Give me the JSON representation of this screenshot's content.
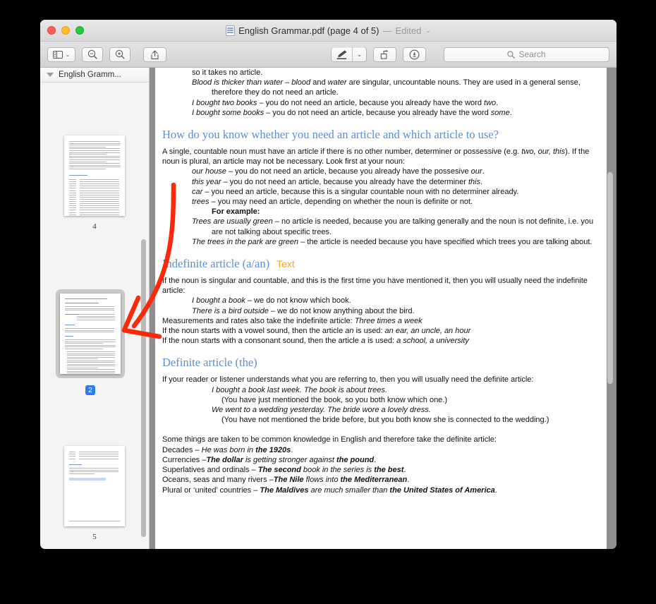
{
  "window": {
    "title_file": "English Grammar.pdf (page 4 of 5)",
    "title_sep": "—",
    "title_edited": "Edited",
    "title_chevron": "⌄"
  },
  "toolbar": {
    "sidebar_button": "sidebar-view",
    "sidebar_chevron": "⌄",
    "zoom_out": "zoom-out",
    "zoom_in": "zoom-in",
    "share": "share",
    "markup": "markup-pen",
    "markup_chevron": "⌄",
    "rotate": "rotate-left",
    "sign": "annotate",
    "search_placeholder": "Search",
    "search_value": ""
  },
  "sidebar": {
    "header_label": "English Gramm...",
    "thumbnails": [
      {
        "label": "4",
        "selected": false
      },
      {
        "label": "2",
        "selected": true
      },
      {
        "label": "5",
        "selected": false
      }
    ]
  },
  "annotations": {
    "text_note": "Text",
    "text_note_color": "#f5a623",
    "arrow_color": "#f92a09"
  },
  "document": {
    "blocks": [
      {
        "cls": "ind1h",
        "html": "so it takes no article."
      },
      {
        "cls": "hang",
        "html": "<span class=\"i\">Blood is thicker than water</span> – <span class=\"i\">blood</span> and <span class=\"i\">water</span> are singular, uncountable nouns. They are used in a general sense, therefore they do not need an article."
      },
      {
        "cls": "hang",
        "html": "<span class=\"i\">I bought two books</span> – you do not need an article, because you already have the word <span class=\"i\">two</span>."
      },
      {
        "cls": "hang",
        "html": "<span class=\"i\">I bought some books</span> – you do not need an article, because you already have the word <span class=\"i\">some</span>."
      },
      {
        "cls": "h2",
        "html": "How do you know whether you need an article and which article to use?"
      },
      {
        "cls": "",
        "html": "A single, countable noun must have an article if there is no other number, determiner or possessive (e.g. <span class=\"i\">two, our, this</span>). If the noun is plural, an article may not be necessary. Look first at your noun:"
      },
      {
        "cls": "hang",
        "html": "<span class=\"i\">our house</span> – you do not need an article, because you already have the possesive <span class=\"i\">our</span>."
      },
      {
        "cls": "hang",
        "html": "<span class=\"i\">this year</span> – you do not need an article, because you already have the determiner <span class=\"i\">this</span>."
      },
      {
        "cls": "hang",
        "html": "<span class=\"i\">car</span> – you need an article, because this is a singular countable noun with no determiner already."
      },
      {
        "cls": "hang",
        "html": "<span class=\"i\">trees</span> – you may need an article, depending on whether the noun is definite or not."
      },
      {
        "cls": "ind2",
        "html": "<span class=\"b\">For example:</span>"
      },
      {
        "cls": "hang",
        "html": "<span class=\"i\">Trees are usually green</span> – no article is needed, because you are talking generally and the noun is not definite, i.e. you are not talking about specific trees."
      },
      {
        "cls": "hang",
        "html": "<span class=\"i\">The trees in the park are green</span> – the article is needed because you have specified which trees you are talking about."
      },
      {
        "cls": "h2",
        "html": "Indefinite article (a/an)"
      },
      {
        "cls": "",
        "html": "If the noun is singular and countable, and this is the first time you have mentioned it, then you will usually need the indefinite article:"
      },
      {
        "cls": "hang",
        "html": "<span class=\"i\">I bought a book</span> – we do not know which book."
      },
      {
        "cls": "hang",
        "html": "<span class=\"i\">There is a bird outside</span> – we do not know anything about the bird."
      },
      {
        "cls": "",
        "html": "Measurements and rates also take the indefinite article: <span class=\"i\">Three times a week</span>"
      },
      {
        "cls": "",
        "html": "If the noun starts with a vowel sound, then the article <span class=\"i\">an</span> is used: <span class=\"i\">an ear, an uncle, an hour</span>"
      },
      {
        "cls": "",
        "html": "If the noun starts with a consonant sound, then the article <span class=\"i\">a</span> is used: <span class=\"i\">a school, a university</span>"
      },
      {
        "cls": "h2",
        "html": "Definite article (the)"
      },
      {
        "cls": "",
        "html": "If your reader or listener understands what you are referring to, then you will usually need the definite article:"
      },
      {
        "cls": "ind2",
        "html": "<span class=\"i\">I bought a book last week. The book is about trees.</span>"
      },
      {
        "cls": "ind3",
        "html": "(You have just mentioned the book, so you both know which one.)"
      },
      {
        "cls": "ind2",
        "html": "<span class=\"i\">We went to a wedding yesterday. The bride wore a lovely dress.</span>"
      },
      {
        "cls": "hang2",
        "html": "(You have not mentioned the bride before, but you both know she is connected to the wedding.)"
      },
      {
        "cls": "",
        "html": "Some things are taken to be common knowledge in English and therefore take the definite article:"
      },
      {
        "cls": "",
        "html": "Decades – <span class=\"i\">He was born in </span><span class=\"bi\">the 1920s</span>."
      },
      {
        "cls": "",
        "html": "Currencies –<span class=\"bi\">The dollar</span><span class=\"i\"> is getting stronger against </span><span class=\"bi\">the pound</span>."
      },
      {
        "cls": "",
        "html": "Superlatives and ordinals – <span class=\"bi\">The second</span><span class=\"i\"> book in the series is </span><span class=\"bi\">the best</span>."
      },
      {
        "cls": "",
        "html": "Oceans, seas and many rivers –<span class=\"bi\">The Nile</span><span class=\"i\"> flows into </span><span class=\"bi\">the Mediterranean</span>."
      },
      {
        "cls": "",
        "html": "Plural or ‘united’ countries – <span class=\"bi\">The Maldives</span><span class=\"i\"> are much smaller than </span><span class=\"bi\">the United States of America</span>."
      }
    ]
  }
}
